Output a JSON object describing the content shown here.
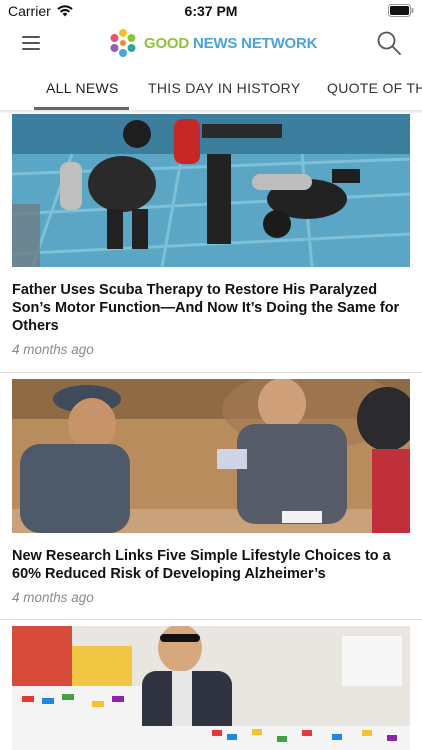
{
  "status_bar": {
    "carrier": "Carrier",
    "time": "6:37 PM",
    "icons": [
      "wifi-icon",
      "battery-icon"
    ]
  },
  "header": {
    "logo_good": "GOOD",
    "logo_news": "NEWS NETWORK",
    "icons": [
      "menu-icon",
      "search-icon"
    ]
  },
  "tabs": [
    {
      "label": "ALL NEWS",
      "active": true
    },
    {
      "label": "THIS DAY IN HISTORY",
      "active": false
    },
    {
      "label": "QUOTE OF THE DAY",
      "active": false
    }
  ],
  "articles": [
    {
      "title": "Father Uses Scuba Therapy to Restore His Paralyzed Son’s Motor Function—And Now It’s Doing the Same for Others",
      "age": "4 months ago",
      "image": "scuba-divers-in-pool"
    },
    {
      "title": "New Research Links Five Simple Lifestyle Choices to a 60% Reduced Risk of Developing Alzheimer’s",
      "age": "4 months ago",
      "image": "elderly-people-playing-cards"
    },
    {
      "title": "",
      "age": "",
      "image": "man-with-lego-bricks"
    }
  ],
  "colors": {
    "logo_good": "#8fc43a",
    "logo_news": "#4aa4d6",
    "age_text": "#8a8a8a",
    "tab_underline": "#666666"
  }
}
